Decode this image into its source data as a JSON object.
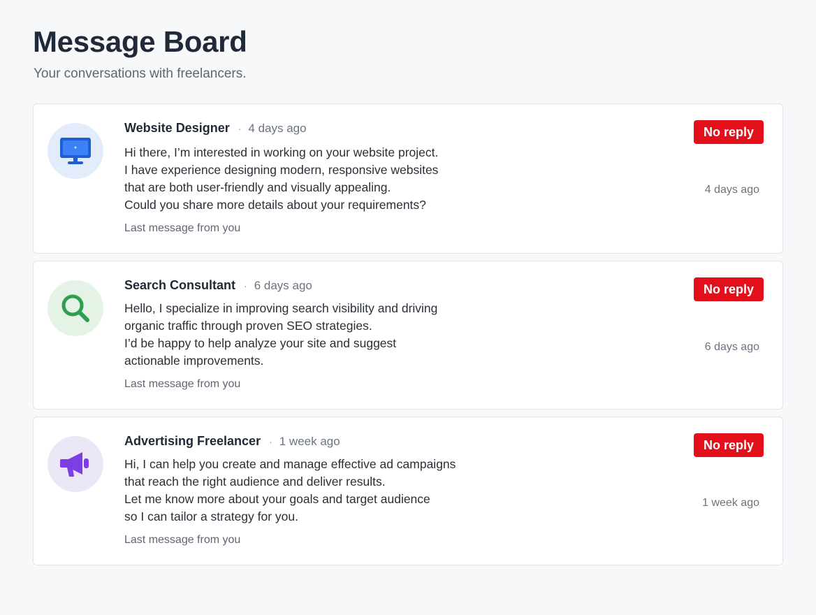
{
  "page": {
    "title": "Message Board",
    "subtitle": "Your conversations with freelancers."
  },
  "threads": [
    {
      "name": "Website Designer",
      "time": "4 days ago",
      "icon": "monitor-icon",
      "avatar_bg": "#e3ecfa",
      "icon_color": "#1f5fd6",
      "lines": [
        "Hi there, I’m interested in working on your website project.",
        "I have experience designing modern, responsive websites",
        "that are both user-friendly and visually appealing.",
        "Could you share more details about your requirements?"
      ],
      "footer": "Last message from you",
      "badge": "No reply",
      "side_time": "4 days ago"
    },
    {
      "name": "Search Consultant",
      "time": "6 days ago",
      "icon": "magnifier-icon",
      "avatar_bg": "#e4f3e6",
      "icon_color": "#2e9e4f",
      "lines": [
        "Hello, I specialize in improving search visibility and driving",
        "organic traffic through proven SEO strategies.",
        "I’d be happy to help analyze your site and suggest",
        "actionable improvements."
      ],
      "footer": "Last message from you",
      "badge": "No reply",
      "side_time": "6 days ago"
    },
    {
      "name": "Advertising Freelancer",
      "time": "1 week ago",
      "icon": "megaphone-icon",
      "avatar_bg": "#ece7f7",
      "icon_color": "#7b3fe4",
      "lines": [
        "Hi, I can help you create and manage effective ad campaigns",
        "that reach the right audience and deliver results.",
        "Let me know more about your goals and target audience",
        "so I can tailor a strategy for you."
      ],
      "footer": "Last message from you",
      "badge": "No reply",
      "side_time": "1 week ago"
    }
  ],
  "colors": {
    "badge": "#e3101c",
    "page_bg": "#f7f8f9"
  }
}
